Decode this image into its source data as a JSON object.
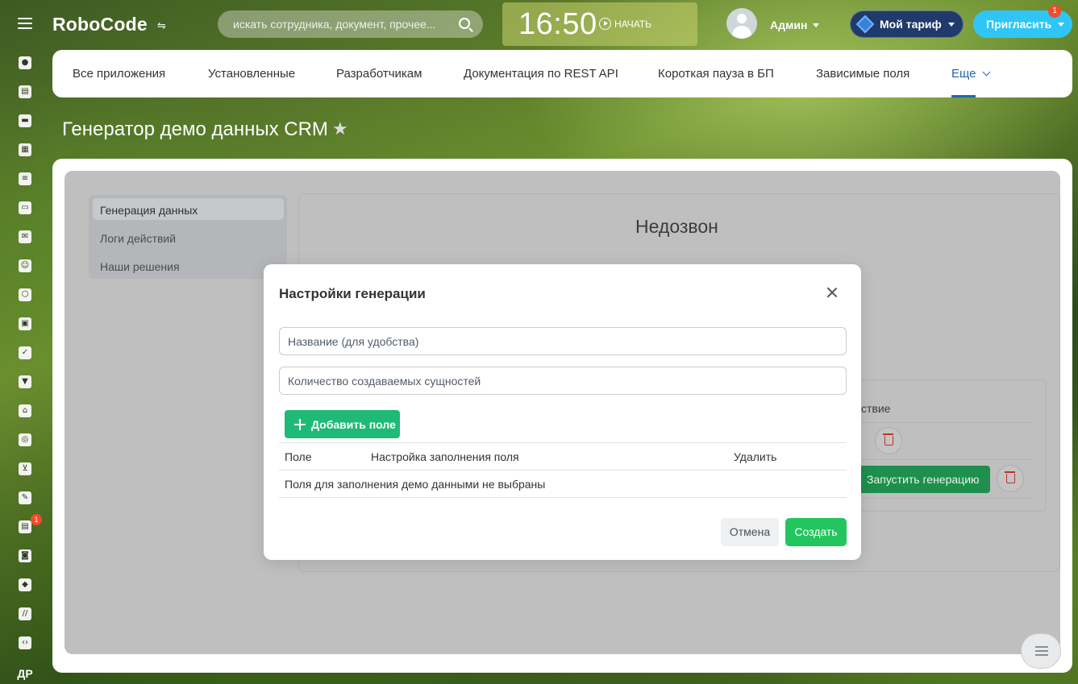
{
  "header": {
    "logo": "RoboCode",
    "search_placeholder": "искать сотрудника, документ, прочее...",
    "clock": "16:50",
    "start_label": "НАЧАТЬ",
    "user_name": "Админ",
    "tariff_label": "Мой тариф",
    "invite_label": "Пригласить",
    "invite_badge": "1"
  },
  "sidebar": {
    "icons": [
      "apps-icon",
      "feed-icon",
      "chat-icon",
      "calendar-icon",
      "document-icon",
      "drive-icon",
      "mail-icon",
      "team-icon",
      "hexagon-icon",
      "presentation-icon",
      "tasks-icon",
      "filter-icon",
      "bank-icon",
      "target-icon",
      "cart-icon",
      "sign-icon",
      "contact-card-icon",
      "robot-icon",
      "box-icon",
      "market-icon",
      "code-icon"
    ],
    "badge": "1",
    "bottom_text": "ДР"
  },
  "tabs": [
    {
      "label": "Все приложения"
    },
    {
      "label": "Установленные"
    },
    {
      "label": "Разработчикам"
    },
    {
      "label": "Документация по REST API"
    },
    {
      "label": "Короткая пауза в БП"
    },
    {
      "label": "Зависимые поля"
    },
    {
      "label": "Еще"
    }
  ],
  "page_title": "Генератор демо данных CRM",
  "left_menu": [
    {
      "label": "Генерация данных"
    },
    {
      "label": "Логи действий"
    },
    {
      "label": "Наши решения"
    }
  ],
  "background": {
    "heading": "Недозвон",
    "column_header": "ствие",
    "run_button": "Запустить генерацию"
  },
  "modal": {
    "title": "Настройки генерации",
    "name_placeholder": "Название (для удобства)",
    "count_placeholder": "Количество создаваемых сущностей",
    "add_field_label": "Добавить поле",
    "columns": [
      "Поле",
      "Настройка заполнения поля",
      "Удалить"
    ],
    "empty_text": "Поля для заполнения демо данными не выбраны",
    "cancel_label": "Отмена",
    "create_label": "Создать"
  },
  "colors": {
    "accent_blue": "#2067b0",
    "invite": "#2fc6f6",
    "tariff": "#1f3a6b",
    "create": "#22c55e",
    "add_field": "#1fb978",
    "badge": "#f04c2d"
  }
}
